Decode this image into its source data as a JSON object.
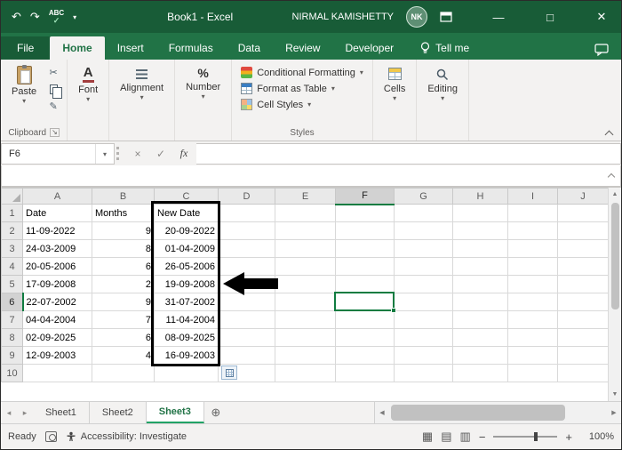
{
  "colors": {
    "title_green": "#185c37",
    "ribbon_green": "#217346",
    "accent_green": "#107c41",
    "sheet_accent": "#21a366"
  },
  "titlebar": {
    "title": "Book1 - Excel",
    "user_name": "NIRMAL KAMISHETTY",
    "avatar_initials": "NK",
    "spell_icon_text": "ABC"
  },
  "ribbon_tabs": {
    "file": "File",
    "home": "Home",
    "insert": "Insert",
    "formulas": "Formulas",
    "data": "Data",
    "review": "Review",
    "developer": "Developer",
    "tell_me": "Tell me"
  },
  "ribbon": {
    "paste_label": "Paste",
    "clipboard_group": "Clipboard",
    "font_group": "Font",
    "alignment_group": "Alignment",
    "number_group": "Number",
    "conditional_formatting": "Conditional Formatting",
    "format_as_table": "Format as Table",
    "cell_styles": "Cell Styles",
    "styles_group": "Styles",
    "cells_group": "Cells",
    "editing_group": "Editing"
  },
  "formula_bar": {
    "name_box": "F6",
    "fx_label": "fx"
  },
  "grid": {
    "selected_cell": "F6",
    "columns": [
      "A",
      "B",
      "C",
      "D",
      "E",
      "F",
      "G",
      "H",
      "I",
      "J"
    ],
    "rows": [
      {
        "n": "1",
        "a": "Date",
        "b": "Months",
        "c": "New Date"
      },
      {
        "n": "2",
        "a": "11-09-2022",
        "b": "9",
        "c": "20-09-2022"
      },
      {
        "n": "3",
        "a": "24-03-2009",
        "b": "8",
        "c": "01-04-2009"
      },
      {
        "n": "4",
        "a": "20-05-2006",
        "b": "6",
        "c": "26-05-2006"
      },
      {
        "n": "5",
        "a": "17-09-2008",
        "b": "2",
        "c": "19-09-2008"
      },
      {
        "n": "6",
        "a": "22-07-2002",
        "b": "9",
        "c": "31-07-2002"
      },
      {
        "n": "7",
        "a": "04-04-2004",
        "b": "7",
        "c": "11-04-2004"
      },
      {
        "n": "8",
        "a": "02-09-2025",
        "b": "6",
        "c": "08-09-2025"
      },
      {
        "n": "9",
        "a": "12-09-2003",
        "b": "4",
        "c": "16-09-2003"
      },
      {
        "n": "10",
        "a": "",
        "b": "",
        "c": ""
      }
    ]
  },
  "sheet_bar": {
    "tabs": [
      "Sheet1",
      "Sheet2",
      "Sheet3"
    ],
    "active_tab": "Sheet3"
  },
  "status_bar": {
    "ready": "Ready",
    "accessibility": "Accessibility: Investigate",
    "zoom": "100%"
  }
}
